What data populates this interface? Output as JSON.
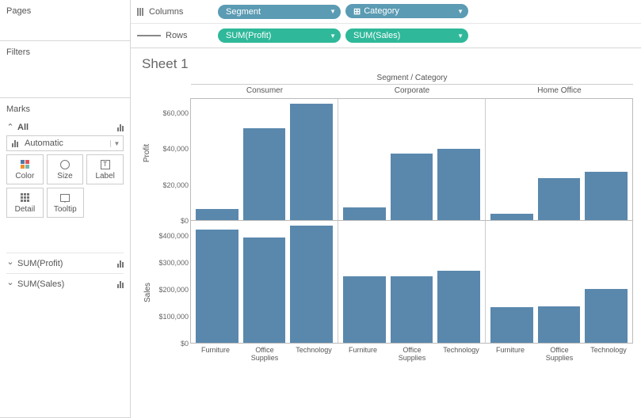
{
  "sidebar": {
    "pages_title": "Pages",
    "filters_title": "Filters",
    "marks_title": "Marks",
    "all_label": "All",
    "mark_type": "Automatic",
    "cards": [
      {
        "label": "Color"
      },
      {
        "label": "Size"
      },
      {
        "label": "Label"
      },
      {
        "label": "Detail"
      },
      {
        "label": "Tooltip"
      }
    ],
    "measures": [
      "SUM(Profit)",
      "SUM(Sales)"
    ]
  },
  "shelves": {
    "columns_label": "Columns",
    "rows_label": "Rows",
    "columns": [
      {
        "label": "Segment",
        "type": "dim",
        "expand": false
      },
      {
        "label": "Category",
        "type": "dim",
        "expand": true
      }
    ],
    "rows": [
      {
        "label": "SUM(Profit)",
        "type": "meas"
      },
      {
        "label": "SUM(Sales)",
        "type": "meas"
      }
    ]
  },
  "viz": {
    "title": "Sheet 1",
    "header": "Segment / Category",
    "segments": [
      "Consumer",
      "Corporate",
      "Home Office"
    ],
    "categories": [
      "Furniture",
      "Office Supplies",
      "Technology"
    ],
    "category_display": [
      "Furniture",
      "Office\nSupplies",
      "Technology"
    ],
    "profit_axis_label": "Profit",
    "sales_axis_label": "Sales",
    "profit_ticks": [
      "$0",
      "$20,000",
      "$40,000",
      "$60,000"
    ],
    "sales_ticks": [
      "$0",
      "$100,000",
      "$200,000",
      "$300,000",
      "$400,000"
    ]
  },
  "chart_data": [
    {
      "type": "bar",
      "title": "Profit by Segment / Category",
      "ylabel": "Profit",
      "ylim": [
        0,
        75000
      ],
      "categories": [
        "Furniture",
        "Office Supplies",
        "Technology"
      ],
      "series": [
        {
          "name": "Consumer",
          "values": [
            7000,
            57000,
            72000
          ]
        },
        {
          "name": "Corporate",
          "values": [
            8000,
            41000,
            44000
          ]
        },
        {
          "name": "Home Office",
          "values": [
            4000,
            26000,
            30000
          ]
        }
      ]
    },
    {
      "type": "bar",
      "title": "Sales by Segment / Category",
      "ylabel": "Sales",
      "ylim": [
        0,
        420000
      ],
      "categories": [
        "Furniture",
        "Office Supplies",
        "Technology"
      ],
      "series": [
        {
          "name": "Consumer",
          "values": [
            390000,
            362000,
            405000
          ]
        },
        {
          "name": "Corporate",
          "values": [
            228000,
            230000,
            248000
          ]
        },
        {
          "name": "Home Office",
          "values": [
            122000,
            125000,
            185000
          ]
        }
      ]
    }
  ]
}
